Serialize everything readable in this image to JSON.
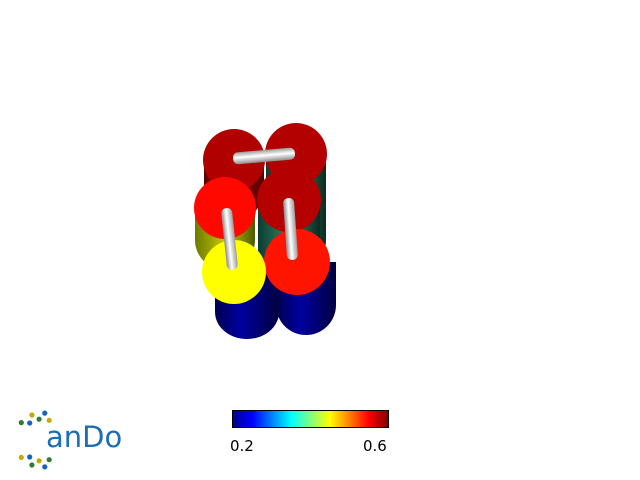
{
  "scene": {
    "helices": [
      {
        "id": "h-top-left",
        "cap_color": "#b00000",
        "body_color": "#9a0000"
      },
      {
        "id": "h-top-right",
        "cap_color": "#b00000",
        "body_color": "#1f6b54"
      },
      {
        "id": "h-mid-left",
        "cap_color": "#ff0a00",
        "body_color": "#ff2a00"
      },
      {
        "id": "h-mid-right",
        "cap_color": "#b00000",
        "body_color": "#1f6b54"
      },
      {
        "id": "h-bottom-left",
        "cap_color": "#ffff00",
        "body_color": "#000070"
      },
      {
        "id": "h-bottom-right",
        "cap_color": "#ff1a00",
        "body_color": "#000070"
      }
    ],
    "connector_color": "#d8d8d8"
  },
  "colorbar": {
    "min_label": "0.2",
    "max_label": "0.6",
    "colormap": "jet",
    "colors": [
      "#00008f",
      "#0000ff",
      "#0080ff",
      "#00ffff",
      "#80ff80",
      "#ffff00",
      "#ff8000",
      "#ff0000",
      "#800000"
    ]
  },
  "logo": {
    "text": "anDo",
    "letter_C_icon": "dna-helix-icon",
    "text_color": "#1e6eb4",
    "bead_colors": [
      "#2e7d32",
      "#1565c0",
      "#c8a800"
    ]
  }
}
